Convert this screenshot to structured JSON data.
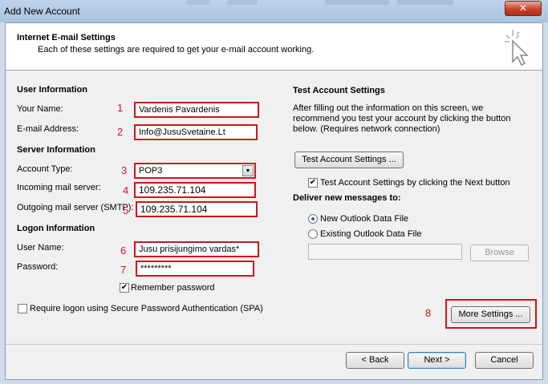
{
  "window": {
    "title": "Add New Account",
    "close_glyph": "✕"
  },
  "header": {
    "title": "Internet E-mail Settings",
    "subtitle": "Each of these settings are required to get your e-mail account working."
  },
  "user_info": {
    "section": "User Information",
    "name_label": "Your Name:",
    "name_value": "Vardenis Pavardenis",
    "email_label": "E-mail Address:",
    "email_value": "Info@JusuSvetaine.Lt"
  },
  "server_info": {
    "section": "Server Information",
    "account_type_label": "Account Type:",
    "account_type_value": "POP3",
    "incoming_label": "Incoming mail server:",
    "incoming_value": "109.235.71.104",
    "outgoing_label": "Outgoing mail server (SMTP):",
    "outgoing_value": "109.235.71.104"
  },
  "logon_info": {
    "section": "Logon Information",
    "username_label": "User Name:",
    "username_value": "Jusu prisijungimo vardas*",
    "password_label": "Password:",
    "password_value": "*********",
    "remember_label": "Remember password",
    "remember_checked": true,
    "spa_label": "Require logon using Secure Password Authentication (SPA)",
    "spa_checked": false
  },
  "test_settings": {
    "section": "Test Account Settings",
    "description": "After filling out the information on this screen, we recommend you test your account by clicking the button below. (Requires network connection)",
    "button": "Test Account Settings ...",
    "auto_test_label": "Test Account Settings by clicking the Next button",
    "auto_test_checked": true
  },
  "deliver": {
    "section": "Deliver new messages to:",
    "option_new": "New Outlook Data File",
    "option_existing": "Existing Outlook Data File",
    "selected": "new",
    "browse_button": "Browse"
  },
  "buttons": {
    "more_settings": "More Settings ...",
    "back": "< Back",
    "next": "Next >",
    "cancel": "Cancel"
  },
  "annotations": [
    "1",
    "2",
    "3",
    "4",
    "5",
    "6",
    "7",
    "8"
  ],
  "colors": {
    "annotation": "#d0141c",
    "title_bar": "#bcd3ea",
    "dialog_bg": "#f0f0f0"
  }
}
